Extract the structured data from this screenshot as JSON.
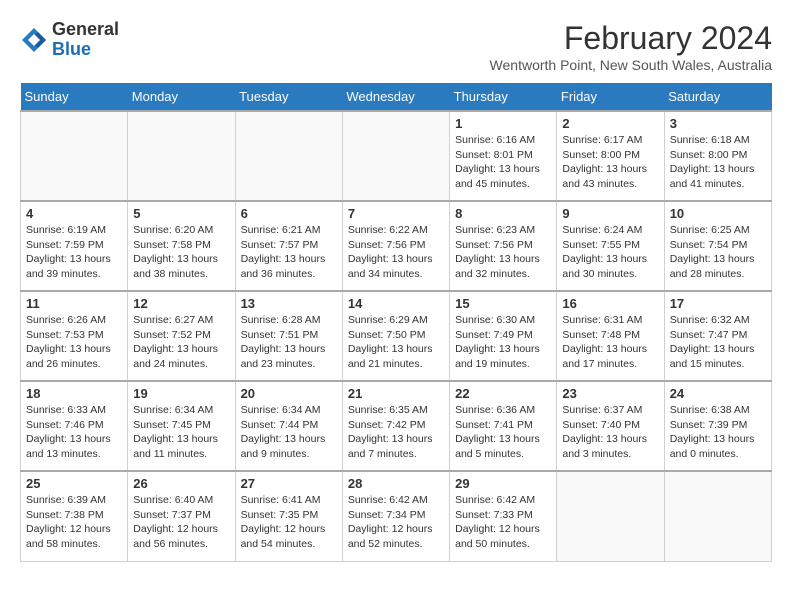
{
  "header": {
    "logo_general": "General",
    "logo_blue": "Blue",
    "month_title": "February 2024",
    "location": "Wentworth Point, New South Wales, Australia"
  },
  "days_of_week": [
    "Sunday",
    "Monday",
    "Tuesday",
    "Wednesday",
    "Thursday",
    "Friday",
    "Saturday"
  ],
  "weeks": [
    [
      {
        "day": "",
        "info": ""
      },
      {
        "day": "",
        "info": ""
      },
      {
        "day": "",
        "info": ""
      },
      {
        "day": "",
        "info": ""
      },
      {
        "day": "1",
        "info": "Sunrise: 6:16 AM\nSunset: 8:01 PM\nDaylight: 13 hours\nand 45 minutes."
      },
      {
        "day": "2",
        "info": "Sunrise: 6:17 AM\nSunset: 8:00 PM\nDaylight: 13 hours\nand 43 minutes."
      },
      {
        "day": "3",
        "info": "Sunrise: 6:18 AM\nSunset: 8:00 PM\nDaylight: 13 hours\nand 41 minutes."
      }
    ],
    [
      {
        "day": "4",
        "info": "Sunrise: 6:19 AM\nSunset: 7:59 PM\nDaylight: 13 hours\nand 39 minutes."
      },
      {
        "day": "5",
        "info": "Sunrise: 6:20 AM\nSunset: 7:58 PM\nDaylight: 13 hours\nand 38 minutes."
      },
      {
        "day": "6",
        "info": "Sunrise: 6:21 AM\nSunset: 7:57 PM\nDaylight: 13 hours\nand 36 minutes."
      },
      {
        "day": "7",
        "info": "Sunrise: 6:22 AM\nSunset: 7:56 PM\nDaylight: 13 hours\nand 34 minutes."
      },
      {
        "day": "8",
        "info": "Sunrise: 6:23 AM\nSunset: 7:56 PM\nDaylight: 13 hours\nand 32 minutes."
      },
      {
        "day": "9",
        "info": "Sunrise: 6:24 AM\nSunset: 7:55 PM\nDaylight: 13 hours\nand 30 minutes."
      },
      {
        "day": "10",
        "info": "Sunrise: 6:25 AM\nSunset: 7:54 PM\nDaylight: 13 hours\nand 28 minutes."
      }
    ],
    [
      {
        "day": "11",
        "info": "Sunrise: 6:26 AM\nSunset: 7:53 PM\nDaylight: 13 hours\nand 26 minutes."
      },
      {
        "day": "12",
        "info": "Sunrise: 6:27 AM\nSunset: 7:52 PM\nDaylight: 13 hours\nand 24 minutes."
      },
      {
        "day": "13",
        "info": "Sunrise: 6:28 AM\nSunset: 7:51 PM\nDaylight: 13 hours\nand 23 minutes."
      },
      {
        "day": "14",
        "info": "Sunrise: 6:29 AM\nSunset: 7:50 PM\nDaylight: 13 hours\nand 21 minutes."
      },
      {
        "day": "15",
        "info": "Sunrise: 6:30 AM\nSunset: 7:49 PM\nDaylight: 13 hours\nand 19 minutes."
      },
      {
        "day": "16",
        "info": "Sunrise: 6:31 AM\nSunset: 7:48 PM\nDaylight: 13 hours\nand 17 minutes."
      },
      {
        "day": "17",
        "info": "Sunrise: 6:32 AM\nSunset: 7:47 PM\nDaylight: 13 hours\nand 15 minutes."
      }
    ],
    [
      {
        "day": "18",
        "info": "Sunrise: 6:33 AM\nSunset: 7:46 PM\nDaylight: 13 hours\nand 13 minutes."
      },
      {
        "day": "19",
        "info": "Sunrise: 6:34 AM\nSunset: 7:45 PM\nDaylight: 13 hours\nand 11 minutes."
      },
      {
        "day": "20",
        "info": "Sunrise: 6:34 AM\nSunset: 7:44 PM\nDaylight: 13 hours\nand 9 minutes."
      },
      {
        "day": "21",
        "info": "Sunrise: 6:35 AM\nSunset: 7:42 PM\nDaylight: 13 hours\nand 7 minutes."
      },
      {
        "day": "22",
        "info": "Sunrise: 6:36 AM\nSunset: 7:41 PM\nDaylight: 13 hours\nand 5 minutes."
      },
      {
        "day": "23",
        "info": "Sunrise: 6:37 AM\nSunset: 7:40 PM\nDaylight: 13 hours\nand 3 minutes."
      },
      {
        "day": "24",
        "info": "Sunrise: 6:38 AM\nSunset: 7:39 PM\nDaylight: 13 hours\nand 0 minutes."
      }
    ],
    [
      {
        "day": "25",
        "info": "Sunrise: 6:39 AM\nSunset: 7:38 PM\nDaylight: 12 hours\nand 58 minutes."
      },
      {
        "day": "26",
        "info": "Sunrise: 6:40 AM\nSunset: 7:37 PM\nDaylight: 12 hours\nand 56 minutes."
      },
      {
        "day": "27",
        "info": "Sunrise: 6:41 AM\nSunset: 7:35 PM\nDaylight: 12 hours\nand 54 minutes."
      },
      {
        "day": "28",
        "info": "Sunrise: 6:42 AM\nSunset: 7:34 PM\nDaylight: 12 hours\nand 52 minutes."
      },
      {
        "day": "29",
        "info": "Sunrise: 6:42 AM\nSunset: 7:33 PM\nDaylight: 12 hours\nand 50 minutes."
      },
      {
        "day": "",
        "info": ""
      },
      {
        "day": "",
        "info": ""
      }
    ]
  ]
}
